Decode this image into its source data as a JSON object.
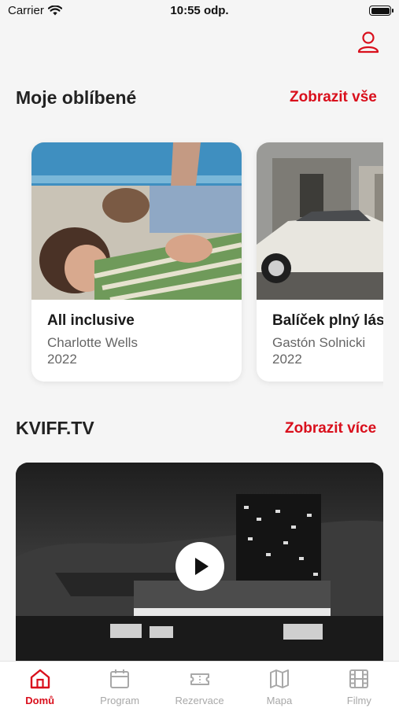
{
  "status": {
    "carrier": "Carrier",
    "time": "10:55 odp."
  },
  "favorites": {
    "title": "Moje oblíbené",
    "link": "Zobrazit vše",
    "items": [
      {
        "title": "All inclusive",
        "director": "Charlotte Wells",
        "year": "2022"
      },
      {
        "title": "Balíček plný lásky",
        "director": "Gastón Solnicki",
        "year": "2022"
      }
    ]
  },
  "tv": {
    "title": "KVIFF.TV",
    "link": "Zobrazit více"
  },
  "tabs": [
    {
      "label": "Domů",
      "icon": "home-icon",
      "active": true
    },
    {
      "label": "Program",
      "icon": "calendar-icon"
    },
    {
      "label": "Rezervace",
      "icon": "ticket-icon"
    },
    {
      "label": "Mapa",
      "icon": "map-icon"
    },
    {
      "label": "Filmy",
      "icon": "film-icon"
    }
  ],
  "colors": {
    "accent": "#d90f1c",
    "background": "#f5f5f5",
    "inactive": "#a8a8a8"
  }
}
